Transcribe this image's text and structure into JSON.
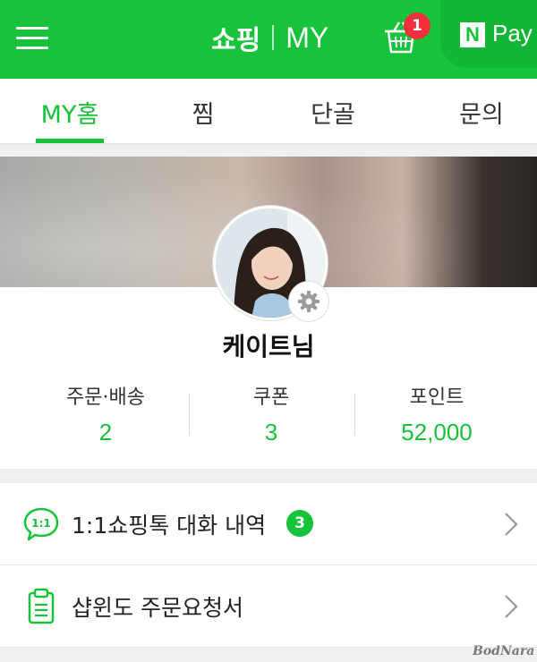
{
  "header": {
    "title_main": "쇼핑",
    "title_sub": "MY",
    "cart_badge": "1",
    "pay_logo": "N",
    "pay_label": "Pay",
    "brand_color": "#16c33a"
  },
  "tabs": [
    {
      "label": "MY홈",
      "active": true
    },
    {
      "label": "찜",
      "active": false
    },
    {
      "label": "단골",
      "active": false
    },
    {
      "label": "문의",
      "active": false
    }
  ],
  "profile": {
    "name": "케이트님",
    "stats": [
      {
        "label": "주문·배송",
        "value": "2"
      },
      {
        "label": "쿠폰",
        "value": "3"
      },
      {
        "label": "포인트",
        "value": "52,000"
      }
    ]
  },
  "menu": [
    {
      "label": "1:1쇼핑톡 대화 내역",
      "count": "3",
      "icon": "chat-bubble-icon",
      "icon_text": "1:1"
    },
    {
      "label": "샵윈도 주문요청서",
      "icon": "clipboard-icon"
    }
  ],
  "watermark": "BodNara"
}
